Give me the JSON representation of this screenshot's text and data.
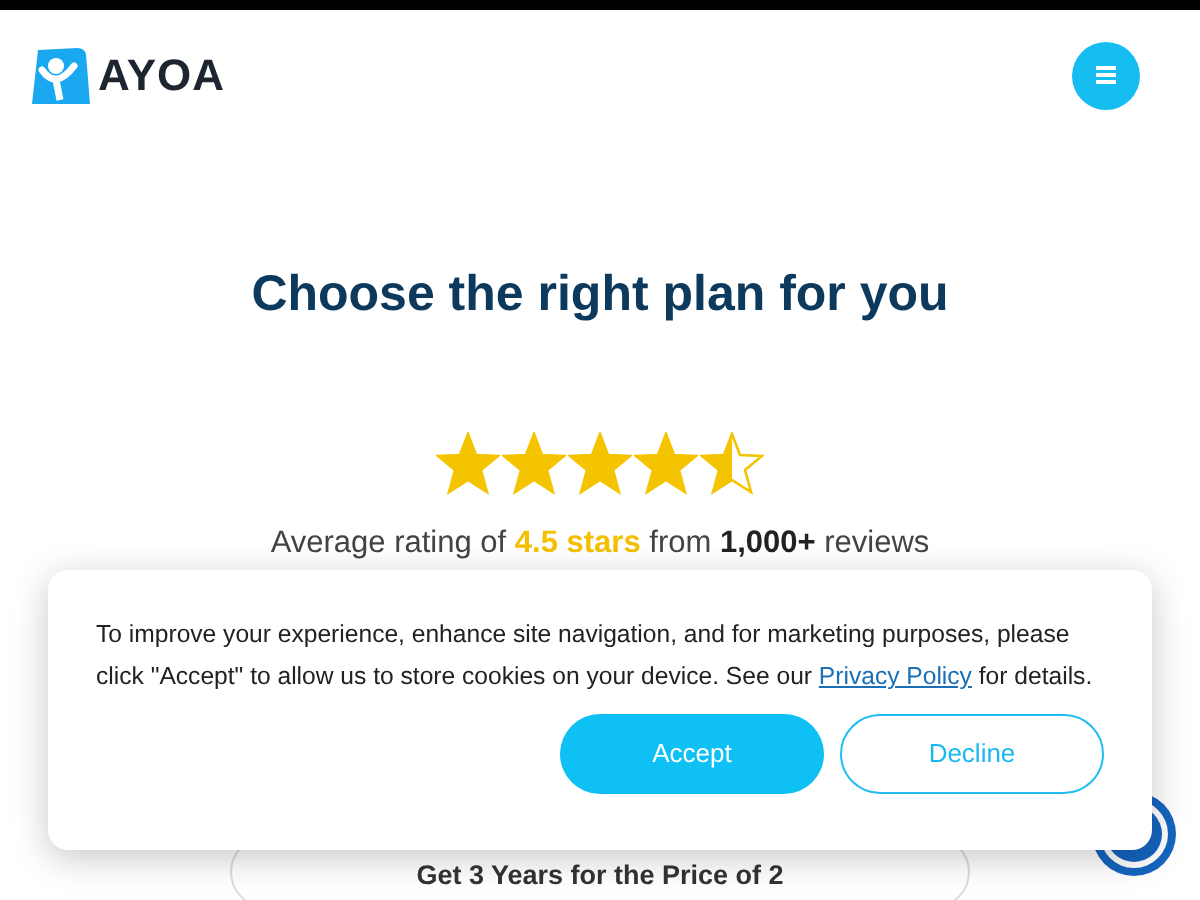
{
  "header": {
    "logo_text": "AYOA"
  },
  "title": "Choose the right plan for you",
  "rating": {
    "stars": 4.5,
    "parts": [
      {
        "kind": "plain",
        "text": "Average rating of "
      },
      {
        "kind": "highlight",
        "text": "4.5 stars"
      },
      {
        "kind": "plain",
        "text": " from "
      },
      {
        "kind": "bold",
        "text": "1,000+"
      },
      {
        "kind": "plain",
        "text": " reviews"
      }
    ]
  },
  "offer": "Get 3 Years for the Price of 2",
  "cookie_banner": {
    "text_before": "To improve your experience, enhance site navigation, and for marketing purposes, please click \"Accept\" to allow us to store cookies on your device. See our ",
    "link": "Privacy Policy",
    "text_after": " for details.",
    "buttons": [
      {
        "kind": "primary",
        "label": "Accept"
      },
      {
        "kind": "outline",
        "label": "Decline"
      }
    ]
  }
}
